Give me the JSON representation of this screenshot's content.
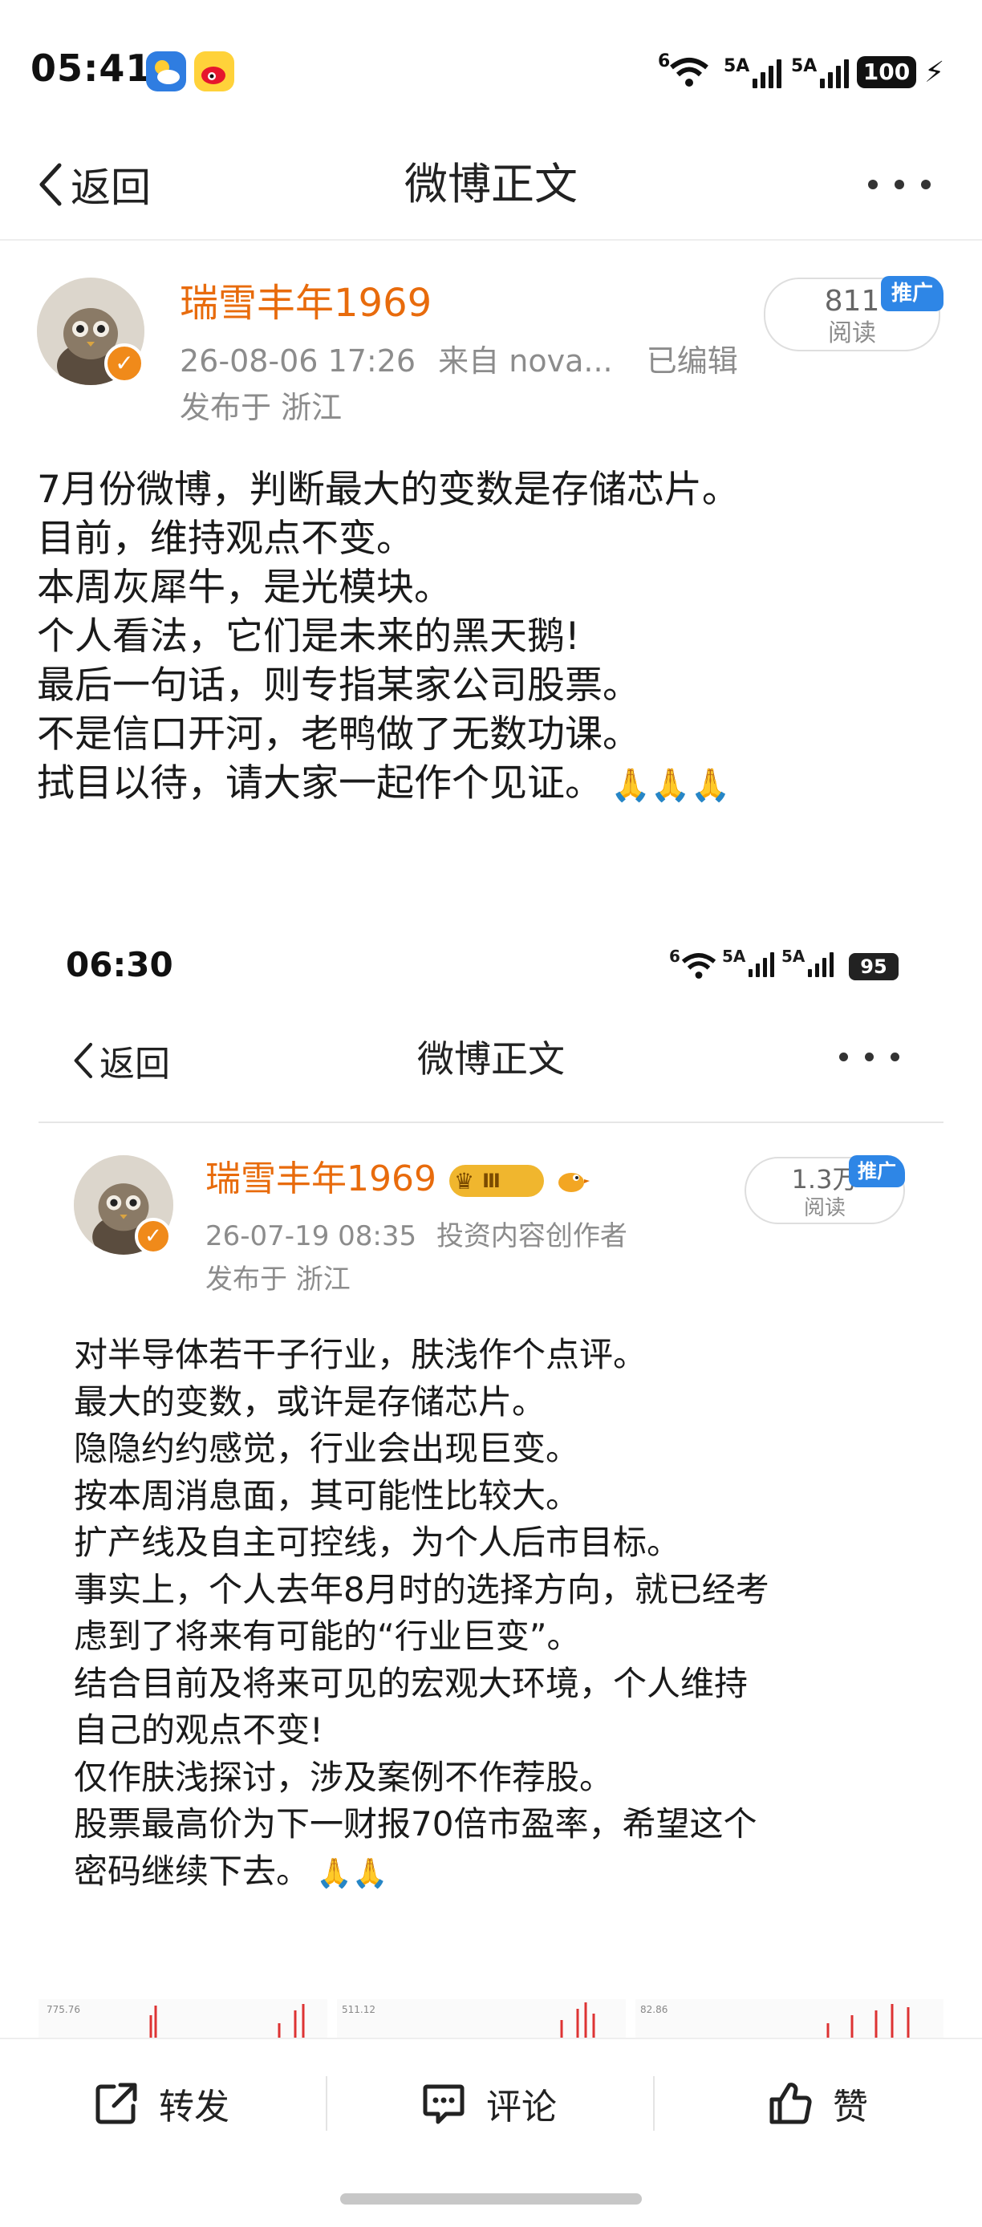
{
  "status_bar": {
    "time": "05:41",
    "network_1": "5A",
    "network_2": "5A",
    "battery": "100",
    "wifi_label": "6"
  },
  "nav": {
    "back_label": "返回",
    "title": "微博正文"
  },
  "post": {
    "username": "瑞雪丰年1969",
    "timestamp": "26-08-06 17:26",
    "source": "来自 nova...",
    "edited": "已编辑",
    "location": "发布于 浙江",
    "read_count": "811",
    "read_label": "阅读",
    "promo_badge": "推广",
    "lines": [
      "7月份微博，判断最大的变数是存储芯片。",
      "目前，维持观点不变。",
      "本周灰犀牛，是光模块。",
      "个人看法，它们是未来的黑天鹅!",
      "最后一句话，则专指某家公司股票。",
      "不是信口开河，老鸭做了无数功课。",
      "拭目以待，请大家一起作个见证。"
    ],
    "emoji": "🙏🙏🙏"
  },
  "embedded": {
    "status_time": "06:30",
    "network_1": "5A",
    "network_2": "5A",
    "battery": "95",
    "wifi_label": "6",
    "nav_back_label": "返回",
    "nav_title": "微博正文",
    "username": "瑞雪丰年1969",
    "rank_badge": "Ⅲ",
    "timestamp": "26-07-19 08:35",
    "creator_tag": "投资内容创作者",
    "location": "发布于 浙江",
    "read_count": "1.3万",
    "read_label": "阅读",
    "promo_badge": "推广",
    "lines": [
      "对半导体若干子行业，肤浅作个点评。",
      "最大的变数，或许是存储芯片。",
      "隐隐约约感觉，行业会出现巨变。",
      "按本周消息面，其可能性比较大。",
      "扩产线及自主可控线，为个人后市目标。",
      "事实上，个人去年8月时的选择方向，就已经考",
      "虑到了将来有可能的“行业巨变”。",
      "结合目前及将来可见的宏观大环境，个人维持",
      "自己的观点不变!",
      "仅作肤浅探讨，涉及案例不作荐股。",
      "股票最高价为下一财报70倍市盈率，希望这个",
      "密码继续下去。"
    ],
    "emoji": "🙏🙏",
    "chart_labels": [
      "775.76",
      "511.12",
      "82.86"
    ]
  },
  "actions": {
    "repost": "转发",
    "comment": "评论",
    "like": "赞"
  },
  "colors": {
    "username": "#e86b0c",
    "promo": "#2e86e6",
    "verified": "#f08a1a",
    "meta": "#8c8c8c"
  }
}
